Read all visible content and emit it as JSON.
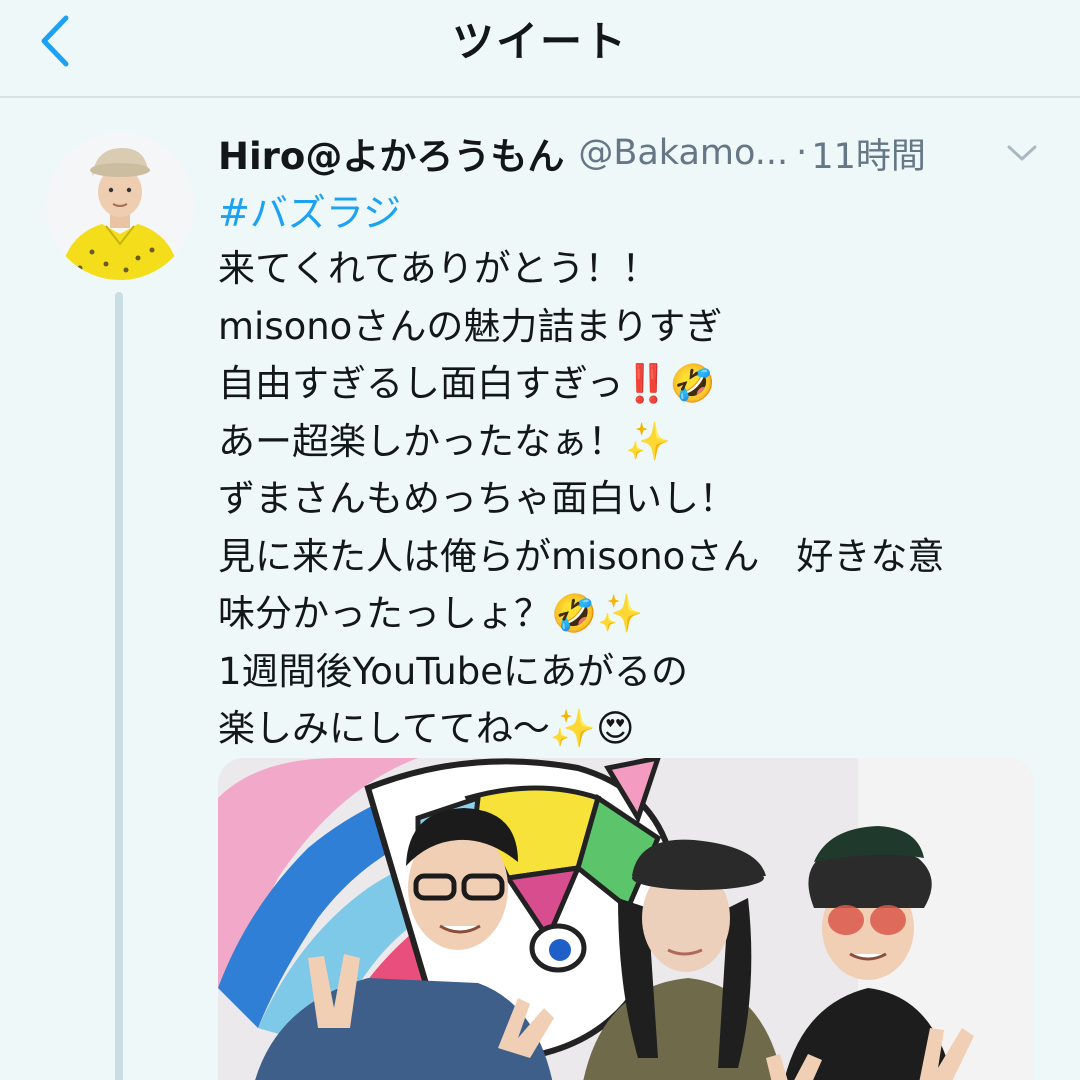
{
  "header": {
    "title": "ツイート",
    "back_icon": "chevron-left-icon"
  },
  "colors": {
    "background": "#eef8f9",
    "accent": "#1da1f2",
    "text": "#14171a",
    "secondary_text": "#657786",
    "thread_line": "#c9dde4"
  },
  "tweet": {
    "display_name": "Hiro@よかろうもん",
    "handle": "@Bakamo...",
    "separator": "·",
    "time": "11時間",
    "hashtag": "#バズラジ",
    "lines": [
      "来てくれてありがとう！！",
      "misonoさんの魅力詰まりすぎ",
      "自由すぎるし面白すぎっ‼️🤣",
      "あー超楽しかったなぁ！✨",
      "ずまさんもめっちゃ面白いし！",
      "見に来た人は俺らがmisonoさん　好きな意",
      "味分かったっしょ？🤣✨",
      "1週間後YouTubeにあがるの",
      "楽しみにしててね〜✨😍"
    ],
    "caret_icon": "chevron-down-icon"
  }
}
